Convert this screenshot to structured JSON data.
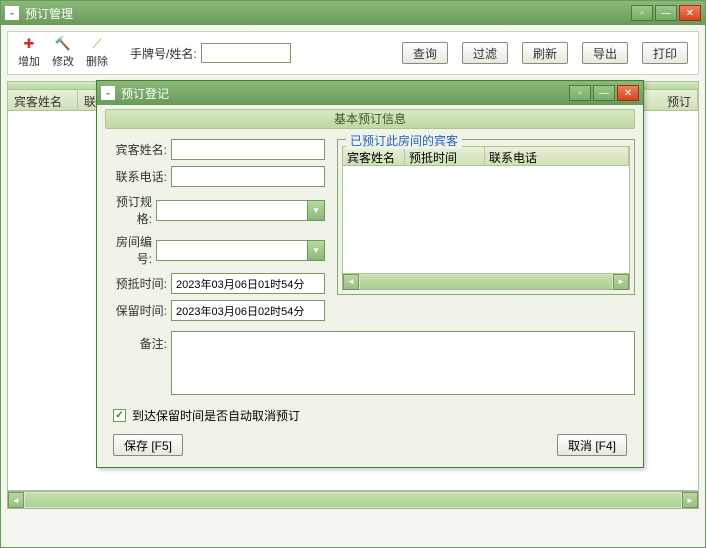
{
  "main": {
    "title": "预订管理",
    "toolbar": {
      "add": "增加",
      "edit": "修改",
      "delete": "删除",
      "search_label": "手牌号/姓名:",
      "search_value": "",
      "query": "查询",
      "filter": "过滤",
      "refresh": "刷新",
      "export": "导出",
      "print": "打印"
    },
    "grid": {
      "col_guest_name": "宾客姓名",
      "col_contact": "联系",
      "col_booking": "预订"
    }
  },
  "dialog": {
    "title": "预订登记",
    "section_title": "基本预订信息",
    "form": {
      "guest_name_label": "宾客姓名:",
      "guest_name_value": "",
      "contact_label": "联系电话:",
      "contact_value": "",
      "spec_label": "预订规格:",
      "spec_value": "",
      "room_label": "房间编号:",
      "room_value": "",
      "arrive_label": "预抵时间:",
      "arrive_value": "2023年03月06日01时54分",
      "hold_label": "保留时间:",
      "hold_value": "2023年03月06日02时54分",
      "remark_label": "备注:",
      "remark_value": ""
    },
    "existing": {
      "legend": "已预订此房间的宾客",
      "col_name": "宾客姓名",
      "col_arrive": "预抵时间",
      "col_contact": "联系电话"
    },
    "checkbox_label": "到达保留时间是否自动取消预订",
    "checkbox_checked": true,
    "save_btn": "保存 [F5]",
    "cancel_btn": "取消 [F4]"
  }
}
